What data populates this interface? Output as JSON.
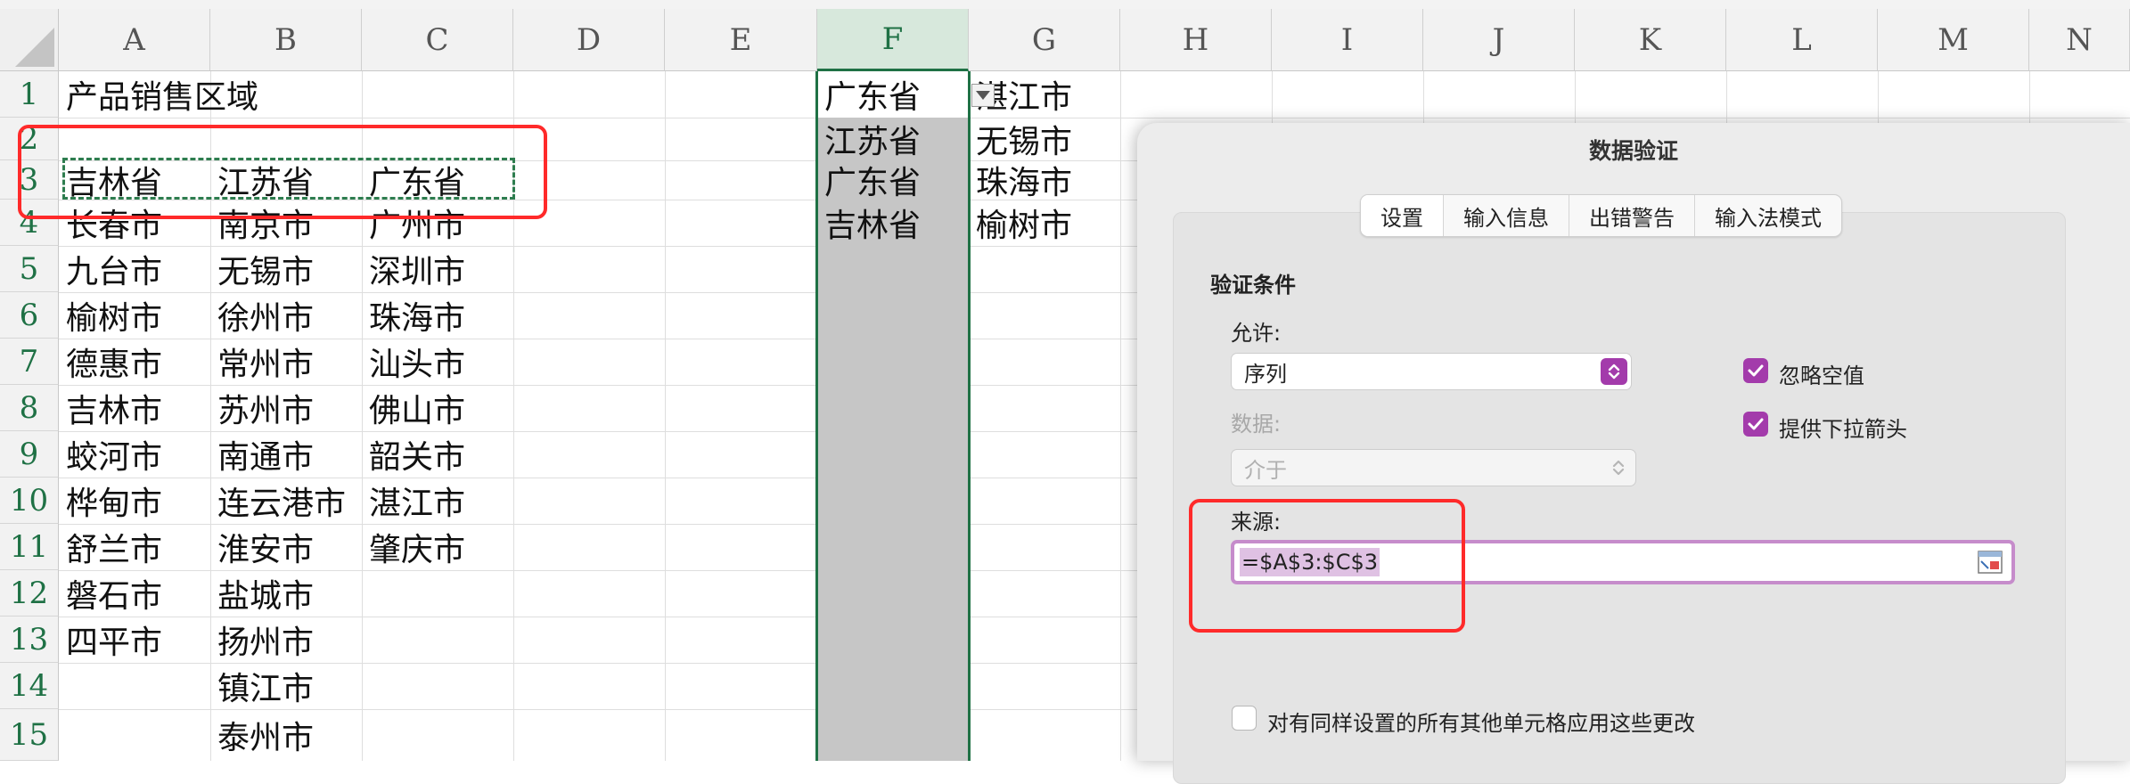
{
  "columns": [
    "A",
    "B",
    "C",
    "D",
    "E",
    "F",
    "G",
    "H",
    "I",
    "J",
    "K",
    "L",
    "M",
    "N"
  ],
  "rows": [
    "1",
    "2",
    "3",
    "4",
    "5",
    "6",
    "7",
    "8",
    "9",
    "10",
    "11",
    "12",
    "13",
    "14",
    "15"
  ],
  "cells": {
    "a1": "产品销售区域",
    "a3": "吉林省",
    "b3": "江苏省",
    "c3": "广东省",
    "a4": "长春市",
    "b4": "南京市",
    "c4": "广州市",
    "a5": "九台市",
    "b5": "无锡市",
    "c5": "深圳市",
    "a6": "榆树市",
    "b6": "徐州市",
    "c6": "珠海市",
    "a7": "德惠市",
    "b7": "常州市",
    "c7": "汕头市",
    "a8": "吉林市",
    "b8": "苏州市",
    "c8": "佛山市",
    "a9": "蛟河市",
    "b9": "南通市",
    "c9": "韶关市",
    "a10": "桦甸市",
    "b10": "连云港市",
    "c10": "湛江市",
    "a11": "舒兰市",
    "b11": "淮安市",
    "c11": "肇庆市",
    "a12": "磐石市",
    "b12": "盐城市",
    "a13": "四平市",
    "b13": "扬州市",
    "b14": "镇江市",
    "b15": "泰州市",
    "f1": "广东省",
    "f2": "江苏省",
    "f3": "广东省",
    "f4": "吉林省",
    "g1": "湛江市",
    "g2": "无锡市",
    "g3": "珠海市",
    "g4": "榆树市"
  },
  "dialog": {
    "title": "数据验证",
    "tabs": [
      "设置",
      "输入信息",
      "出错警告",
      "输入法模式"
    ],
    "active_tab": "设置",
    "section": "验证条件",
    "allow_label": "允许:",
    "allow_value": "序列",
    "data_label": "数据:",
    "data_value": "介于",
    "ignore_blank": "忽略空值",
    "ignore_blank_checked": true,
    "dropdown_arrow": "提供下拉箭头",
    "dropdown_arrow_checked": true,
    "source_label": "来源:",
    "source_value": "=$A$3:$C$3",
    "apply_all": "对有同样设置的所有其他单元格应用这些更改",
    "apply_all_checked": false
  },
  "colors": {
    "excel_green": "#1f7145",
    "accent_purple": "#a33bab",
    "annotation_red": "#ff2a2a"
  }
}
